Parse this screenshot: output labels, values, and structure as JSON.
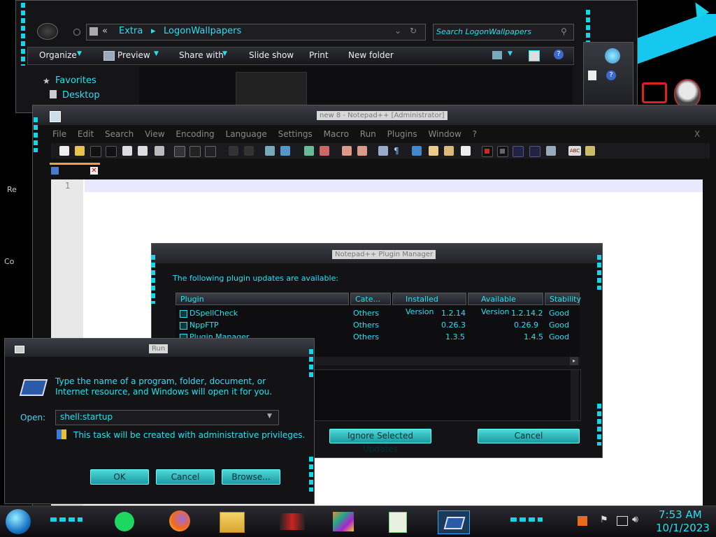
{
  "explorer": {
    "breadcrumb": [
      "Extra",
      "LogonWallpapers"
    ],
    "breadcrumb_prefix": "«",
    "search_placeholder": "Search LogonWallpapers",
    "toolbar": [
      "Organize",
      "Preview",
      "Share with",
      "Slide show",
      "Print",
      "New folder"
    ],
    "nav": [
      "Favorites",
      "Desktop"
    ]
  },
  "notepad": {
    "title": "new 8 - Notepad++ [Administrator]",
    "menu": [
      "File",
      "Edit",
      "Search",
      "View",
      "Encoding",
      "Language",
      "Settings",
      "Macro",
      "Run",
      "Plugins",
      "Window",
      "?"
    ],
    "close_label": "X",
    "line_number": "1"
  },
  "plugin_manager": {
    "title": "Notepad++ Plugin Manager",
    "heading": "The following plugin updates are available:",
    "columns": [
      "Plugin",
      "Cate...",
      "Installed Version",
      "Available Version",
      "Stability"
    ],
    "rows": [
      {
        "name": "DSpellCheck",
        "category": "Others",
        "installed": "1.2.14",
        "available": "1.2.14.2",
        "stability": "Good"
      },
      {
        "name": "NppFTP",
        "category": "Others",
        "installed": "0.26.3",
        "available": "0.26.9",
        "stability": "Good"
      },
      {
        "name": "Plugin Manager",
        "category": "Others",
        "installed": "1.3.5",
        "available": "1.4.5",
        "stability": "Good"
      }
    ],
    "ignore_button": "Ignore Selected Updates",
    "cancel_button": "Cancel"
  },
  "run_dialog": {
    "title": "Run",
    "description": "Type the name of a program, folder, document, or Internet resource, and Windows will open it for you.",
    "open_label": "Open:",
    "open_value": "shell:startup",
    "admin_note": "This task will be created with administrative privileges.",
    "ok": "OK",
    "cancel": "Cancel",
    "browse": "Browse..."
  },
  "desktop_labels": [
    "Re",
    "Co"
  ],
  "taskbar": {
    "time": "7:53 AM",
    "date": "10/1/2023"
  },
  "colors": {
    "accent": "#19d3e8",
    "text_cyan": "#29e0f0",
    "button_teal": "#2fb8bd"
  }
}
